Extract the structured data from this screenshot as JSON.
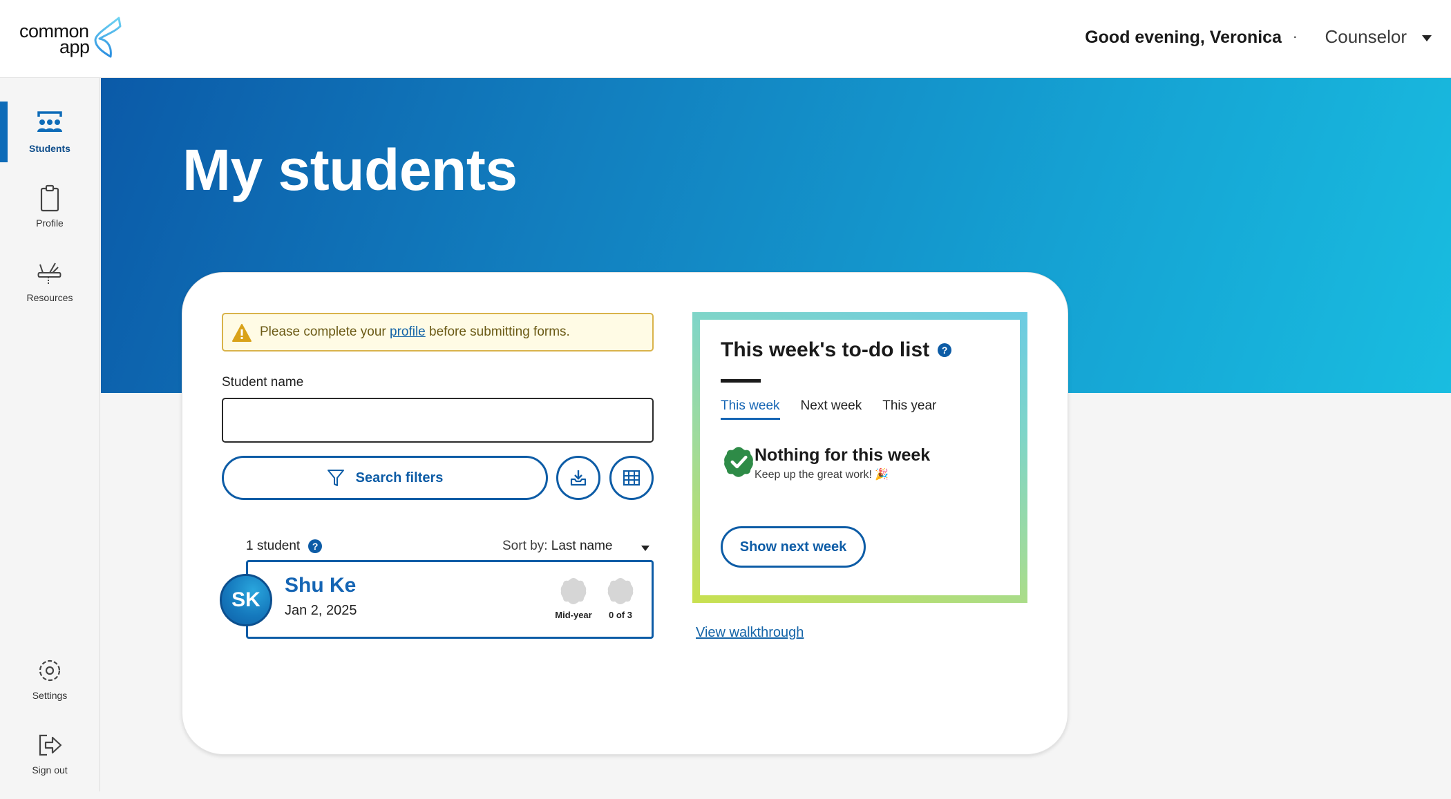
{
  "header": {
    "logo_line1": "common",
    "logo_line2": "app",
    "greeting": "Good evening, Veronica",
    "separator": "·",
    "role": "Counselor"
  },
  "sidebar": {
    "items": [
      {
        "label": "Students",
        "icon": "students-icon",
        "active": true
      },
      {
        "label": "Profile",
        "icon": "clipboard-icon",
        "active": false
      },
      {
        "label": "Resources",
        "icon": "multitool-icon",
        "active": false
      },
      {
        "label": "Settings",
        "icon": "gear-icon",
        "active": false
      },
      {
        "label": "Sign out",
        "icon": "sign-out-icon",
        "active": false
      }
    ]
  },
  "hero": {
    "title": "My students"
  },
  "alert": {
    "text_before": "Please complete your ",
    "link": "profile",
    "text_after": " before submitting forms."
  },
  "search": {
    "label": "Student name",
    "value": "",
    "placeholder": "",
    "filters_label": "Search filters"
  },
  "results": {
    "count": "1 student",
    "sort_label": "Sort by:",
    "sort_value": "Last name"
  },
  "students": [
    {
      "initials": "SK",
      "name": "Shu Ke",
      "date": "Jan 2, 2025",
      "badges": [
        {
          "label": "Mid-year"
        },
        {
          "label": "0 of 3"
        }
      ]
    }
  ],
  "todo": {
    "title": "This week's to-do list",
    "tabs": [
      {
        "label": "This week",
        "active": true
      },
      {
        "label": "Next week",
        "active": false
      },
      {
        "label": "This year",
        "active": false
      }
    ],
    "empty_title": "Nothing for this week",
    "empty_subtitle": "Keep up the great work! 🎉",
    "button": "Show next week"
  },
  "walkthrough_link": "View walkthrough",
  "colors": {
    "primary": "#0d5ca6",
    "link": "#1565a8",
    "success": "#2e8b47",
    "warning": "#d9a21a"
  }
}
